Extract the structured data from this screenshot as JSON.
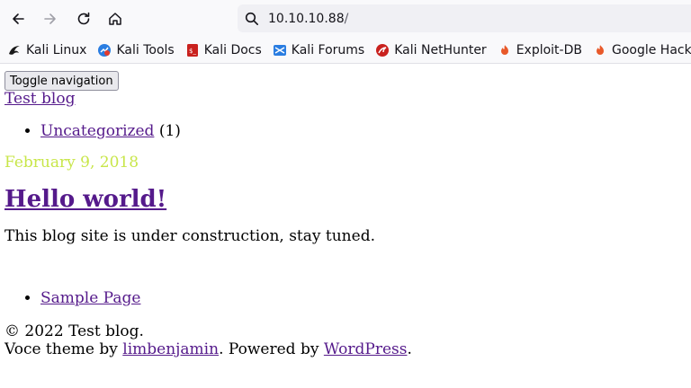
{
  "browser": {
    "url_host": "10.10.10.88",
    "url_path": "/",
    "bookmarks": [
      {
        "label": "Kali Linux",
        "icon": "kali-dragon-icon"
      },
      {
        "label": "Kali Tools",
        "icon": "kali-tools-icon"
      },
      {
        "label": "Kali Docs",
        "icon": "kali-docs-icon"
      },
      {
        "label": "Kali Forums",
        "icon": "kali-forums-icon"
      },
      {
        "label": "Kali NetHunter",
        "icon": "kali-nethunter-icon"
      },
      {
        "label": "Exploit-DB",
        "icon": "exploit-db-icon"
      },
      {
        "label": "Google Hacking D",
        "icon": "ghdb-icon"
      }
    ]
  },
  "page": {
    "toggle_label": "Toggle navigation",
    "brand": "Test blog",
    "categories": [
      {
        "label": "Uncategorized",
        "count": "(1)"
      }
    ],
    "post": {
      "date": "February 9, 2018",
      "title": "Hello world!",
      "excerpt": "This blog site is under construction, stay tuned."
    },
    "pages": [
      {
        "label": "Sample Page"
      }
    ],
    "footer": {
      "copyright": "© 2022 Test blog.",
      "theme_prefix": "Voce theme by ",
      "theme_author": "limbenjamin",
      "powered_prefix": ". Powered by ",
      "powered_link": "WordPress",
      "powered_suffix": "."
    }
  },
  "colors": {
    "link": "#551a8b",
    "date": "#c8e64a"
  }
}
